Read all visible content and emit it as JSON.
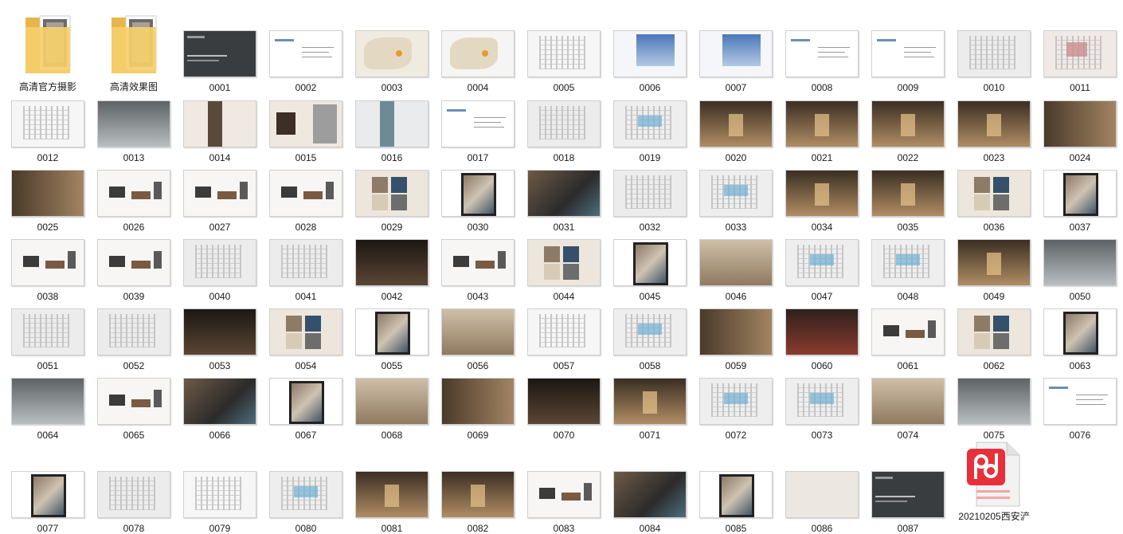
{
  "folders": [
    {
      "name": "高清官方摄影"
    },
    {
      "name": "高清效果图"
    }
  ],
  "files": [
    {
      "name": "0001",
      "style": "dark"
    },
    {
      "name": "0002",
      "style": "text"
    },
    {
      "name": "0003",
      "style": "map"
    },
    {
      "name": "0004",
      "style": "map2"
    },
    {
      "name": "0005",
      "style": "plan-light"
    },
    {
      "name": "0006",
      "style": "photo-blue"
    },
    {
      "name": "0007",
      "style": "photo-blue"
    },
    {
      "name": "0008",
      "style": "text"
    },
    {
      "name": "0009",
      "style": "text"
    },
    {
      "name": "0010",
      "style": "plan"
    },
    {
      "name": "0011",
      "style": "plan-red"
    },
    {
      "name": "0012",
      "style": "plan-light"
    },
    {
      "name": "0013",
      "style": "photo-cool"
    },
    {
      "name": "0014",
      "style": "split"
    },
    {
      "name": "0015",
      "style": "collage"
    },
    {
      "name": "0016",
      "style": "split-blue"
    },
    {
      "name": "0017",
      "style": "text"
    },
    {
      "name": "0018",
      "style": "plan"
    },
    {
      "name": "0019",
      "style": "plan-blue"
    },
    {
      "name": "0020",
      "style": "photo-warm"
    },
    {
      "name": "0021",
      "style": "photo-warm"
    },
    {
      "name": "0022",
      "style": "photo-warm"
    },
    {
      "name": "0023",
      "style": "photo-warm"
    },
    {
      "name": "0024",
      "style": "photo-brown"
    },
    {
      "name": "0025",
      "style": "photo-brown"
    },
    {
      "name": "0026",
      "style": "furniture"
    },
    {
      "name": "0027",
      "style": "furniture"
    },
    {
      "name": "0028",
      "style": "furniture"
    },
    {
      "name": "0029",
      "style": "moodboard"
    },
    {
      "name": "0030",
      "style": "framed"
    },
    {
      "name": "0031",
      "style": "moodboard-dark"
    },
    {
      "name": "0032",
      "style": "plan"
    },
    {
      "name": "0033",
      "style": "plan-blue"
    },
    {
      "name": "0034",
      "style": "photo-warm"
    },
    {
      "name": "0035",
      "style": "photo-warm"
    },
    {
      "name": "0036",
      "style": "moodboard"
    },
    {
      "name": "0037",
      "style": "framed"
    },
    {
      "name": "0038",
      "style": "furniture"
    },
    {
      "name": "0039",
      "style": "furniture"
    },
    {
      "name": "0040",
      "style": "plan"
    },
    {
      "name": "0041",
      "style": "plan"
    },
    {
      "name": "0042",
      "style": "photo-dark"
    },
    {
      "name": "0043",
      "style": "furniture"
    },
    {
      "name": "0044",
      "style": "moodboard"
    },
    {
      "name": "0045",
      "style": "framed"
    },
    {
      "name": "0046",
      "style": "photo-wood"
    },
    {
      "name": "0047",
      "style": "plan-blue"
    },
    {
      "name": "0048",
      "style": "plan-blue"
    },
    {
      "name": "0049",
      "style": "photo-warm"
    },
    {
      "name": "0050",
      "style": "photo-cool"
    },
    {
      "name": "0051",
      "style": "plan"
    },
    {
      "name": "0052",
      "style": "plan"
    },
    {
      "name": "0053",
      "style": "photo-dark"
    },
    {
      "name": "0054",
      "style": "moodboard"
    },
    {
      "name": "0055",
      "style": "framed"
    },
    {
      "name": "0056",
      "style": "photo-wood"
    },
    {
      "name": "0057",
      "style": "plan-light"
    },
    {
      "name": "0058",
      "style": "plan-blue"
    },
    {
      "name": "0059",
      "style": "photo-brown"
    },
    {
      "name": "0060",
      "style": "photo-red"
    },
    {
      "name": "0061",
      "style": "furniture"
    },
    {
      "name": "0062",
      "style": "moodboard"
    },
    {
      "name": "0063",
      "style": "framed"
    },
    {
      "name": "0064",
      "style": "photo-cool"
    },
    {
      "name": "0065",
      "style": "furniture"
    },
    {
      "name": "0066",
      "style": "moodboard-dark"
    },
    {
      "name": "0067",
      "style": "framed"
    },
    {
      "name": "0068",
      "style": "photo-wood"
    },
    {
      "name": "0069",
      "style": "photo-brown"
    },
    {
      "name": "0070",
      "style": "photo-dark"
    },
    {
      "name": "0071",
      "style": "photo-warm"
    },
    {
      "name": "0072",
      "style": "plan-blue"
    },
    {
      "name": "0073",
      "style": "plan-blue"
    },
    {
      "name": "0074",
      "style": "photo-wood"
    },
    {
      "name": "0075",
      "style": "photo-cool"
    },
    {
      "name": "0076",
      "style": "text"
    },
    {
      "name": "0077",
      "style": "framed"
    },
    {
      "name": "0078",
      "style": "plan"
    },
    {
      "name": "0079",
      "style": "plan-light"
    },
    {
      "name": "0080",
      "style": "plan-blue"
    },
    {
      "name": "0081",
      "style": "photo-warm"
    },
    {
      "name": "0082",
      "style": "photo-warm"
    },
    {
      "name": "0083",
      "style": "furniture"
    },
    {
      "name": "0084",
      "style": "moodboard-dark"
    },
    {
      "name": "0085",
      "style": "framed"
    },
    {
      "name": "0086",
      "style": "blank"
    },
    {
      "name": "0087",
      "style": "dark"
    }
  ],
  "pdf": {
    "name": "20210205西安浐",
    "icon": "pdf-icon",
    "brand_color": "#e8303a"
  }
}
